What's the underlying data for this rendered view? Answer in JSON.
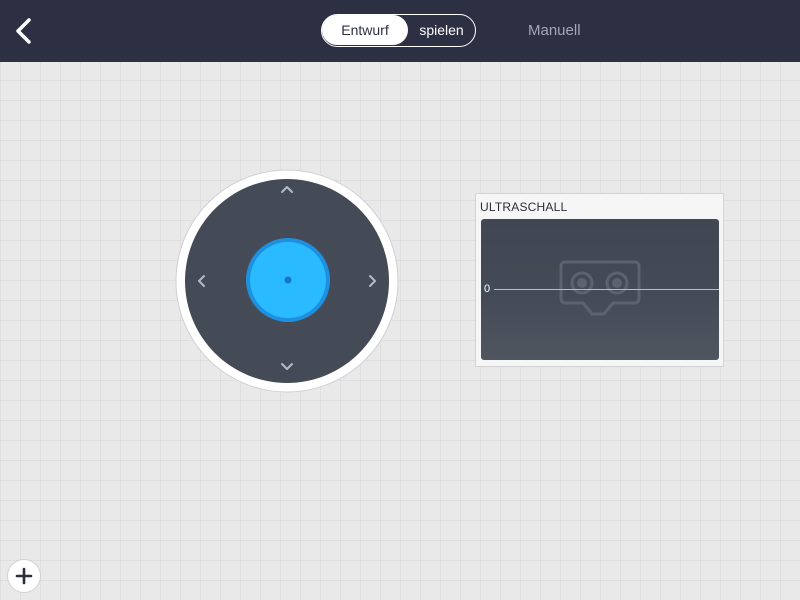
{
  "topbar": {
    "back_icon": "chevron-left-icon",
    "mode_toggle": {
      "active_label": "Entwurf",
      "inactive_label": "spielen"
    },
    "manual_label": "Manuell"
  },
  "joystick": {
    "up_icon": "chevron-up-icon",
    "down_icon": "chevron-down-icon",
    "left_icon": "chevron-left-icon",
    "right_icon": "chevron-right-icon",
    "knob_color": "#29baff"
  },
  "ultrasonic_widget": {
    "title": "ULTRASCHALL",
    "axis_value": "0",
    "placeholder_icon": "vr-goggles-icon",
    "line_color": "#e7c04c"
  },
  "add_button": {
    "icon": "plus-icon"
  },
  "colors": {
    "topbar_bg": "#2d3043",
    "canvas_bg": "#e9e9ea",
    "accent": "#29baff"
  }
}
